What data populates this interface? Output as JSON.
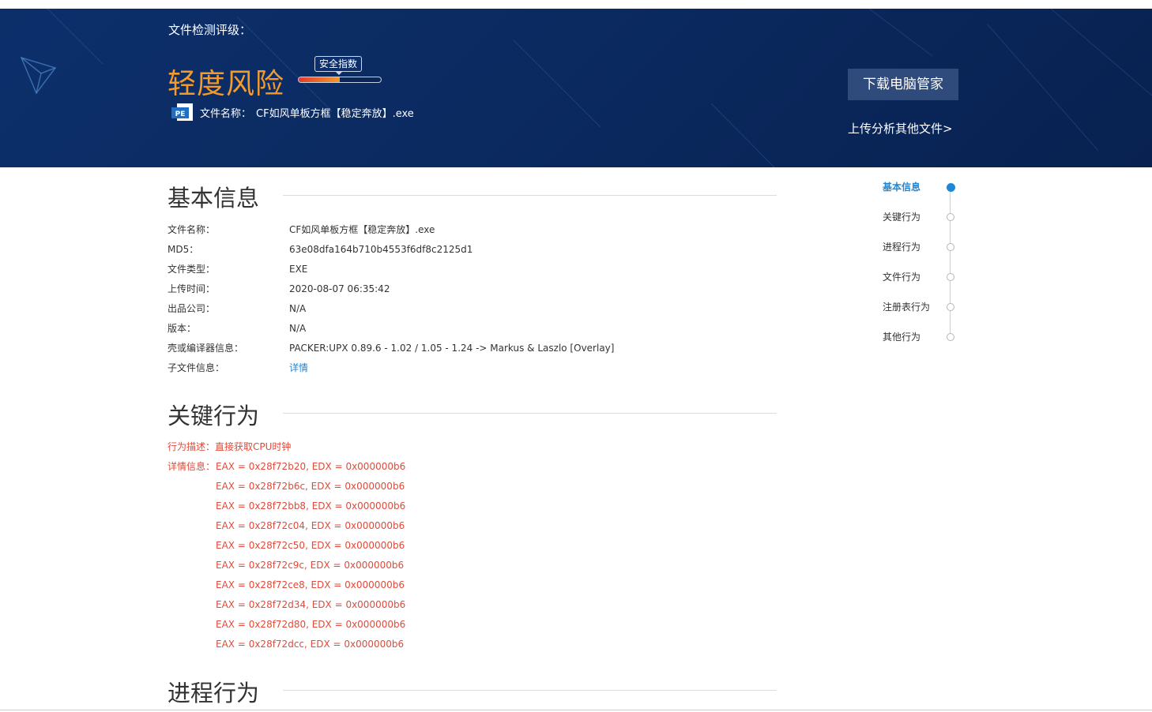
{
  "banner": {
    "rating_label": "文件检测评级：",
    "risk_level": "轻度风险",
    "index_label": "安全指数",
    "index_level": 0.5,
    "file_icon_label": "PE",
    "file_name_label": "文件名称：",
    "file_name_value": "CF如风单板方框【稳定奔放】.exe",
    "download_button": "下载电脑管家",
    "upload_link": "上传分析其他文件>"
  },
  "basic_info": {
    "title": "基本信息",
    "rows": [
      {
        "key": "文件名称：",
        "value": "CF如风单板方框【稳定奔放】.exe"
      },
      {
        "key": "MD5：",
        "value": "63e08dfa164b710b4553f6df8c2125d1"
      },
      {
        "key": "文件类型：",
        "value": "EXE"
      },
      {
        "key": "上传时间：",
        "value": "2020-08-07 06:35:42"
      },
      {
        "key": "出品公司：",
        "value": "N/A"
      },
      {
        "key": "版本：",
        "value": "N/A"
      },
      {
        "key": "壳或编译器信息：",
        "value": "PACKER:UPX 0.89.6 - 1.02 / 1.05 - 1.24 -> Markus & Laszlo [Overlay]"
      },
      {
        "key": "子文件信息：",
        "value": "详情"
      }
    ]
  },
  "key_behavior": {
    "title": "关键行为",
    "desc_label": "行为描述：",
    "desc_value": "直接获取CPU时钟",
    "detail_label": "详情信息：",
    "details": [
      "EAX = 0x28f72b20, EDX = 0x000000b6",
      "EAX = 0x28f72b6c, EDX = 0x000000b6",
      "EAX = 0x28f72bb8, EDX = 0x000000b6",
      "EAX = 0x28f72c04, EDX = 0x000000b6",
      "EAX = 0x28f72c50, EDX = 0x000000b6",
      "EAX = 0x28f72c9c, EDX = 0x000000b6",
      "EAX = 0x28f72ce8, EDX = 0x000000b6",
      "EAX = 0x28f72d34, EDX = 0x000000b6",
      "EAX = 0x28f72d80, EDX = 0x000000b6",
      "EAX = 0x28f72dcc, EDX = 0x000000b6"
    ]
  },
  "process_behavior": {
    "title": "进程行为"
  },
  "side_nav": {
    "items": [
      "基本信息",
      "关键行为",
      "进程行为",
      "文件行为",
      "注册表行为",
      "其他行为"
    ],
    "active_index": 0
  },
  "colors": {
    "banner_bg": "#0c2f6b",
    "risk_orange": "#f39a2b",
    "alert_red": "#e04a3a",
    "link_blue": "#2a83c9",
    "nav_active": "#1f87d6"
  }
}
